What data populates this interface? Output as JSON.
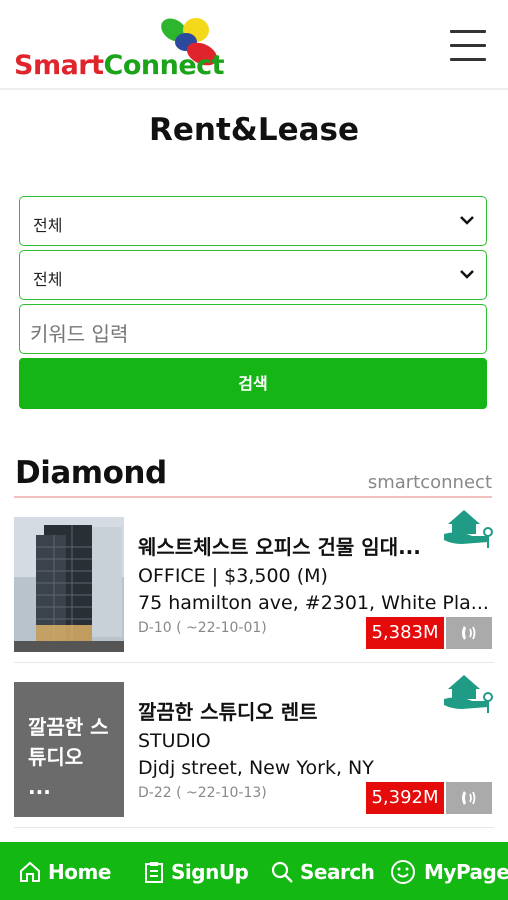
{
  "header": {
    "logo": {
      "part1": "Smart",
      "part2": "Connect"
    },
    "menu_icon": "hamburger-icon"
  },
  "page_title": "Rent&Lease",
  "search": {
    "select1_value": "전체",
    "select2_value": "전체",
    "keyword_placeholder": "키워드 입력",
    "button_label": "검색"
  },
  "section": {
    "title": "Diamond",
    "brand": "smartconnect"
  },
  "listings": [
    {
      "title": "웨스트체스트 오피스 건물 임대...",
      "type_price": "OFFICE | $3,500 (M)",
      "address": "75 hamilton ave, #2301, White Pla...",
      "date": "D-10 ( ~22-10-01)",
      "price_badge": "5,383M",
      "thumb_text": ""
    },
    {
      "title": "깔끔한 스튜디오 렌트",
      "type_price": "STUDIO",
      "address": "Djdj street, New York, NY",
      "date": "D-22 ( ~22-10-13)",
      "price_badge": "5,392M",
      "thumb_text": "깔끔한 스튜디오 ..."
    }
  ],
  "bottom_nav": {
    "home": "Home",
    "signup": "SignUp",
    "search": "Search",
    "mypage": "MyPage"
  },
  "colors": {
    "brand_green": "#14b514",
    "brand_red": "#e0242b",
    "price_red": "#e50b0b",
    "badge_teal": "#1f9b86"
  }
}
